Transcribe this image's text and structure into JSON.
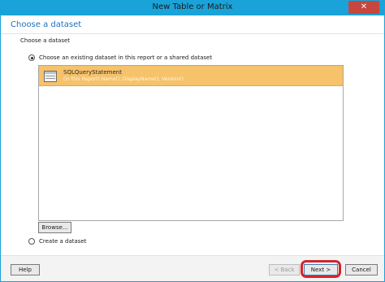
{
  "window": {
    "title": "New Table or Matrix",
    "close_glyph": "✕"
  },
  "header": {
    "title": "Choose a dataset"
  },
  "section": {
    "label": "Choose a dataset"
  },
  "options": {
    "existing_label": "Choose an existing dataset in this report or a shared dataset",
    "create_label": "Create a dataset"
  },
  "datasets": [
    {
      "name": "SQLQueryStatement",
      "details": "(in this Report) Name(), DisplayName(), Version()",
      "selected": true,
      "icon": "dataset-table-icon"
    }
  ],
  "buttons": {
    "browse": "Browse...",
    "help": "Help",
    "back": "< Back",
    "next": "Next >",
    "cancel": "Cancel"
  },
  "colors": {
    "titlebar": "#1aa3d9",
    "selection": "#f6c26a",
    "header_text": "#1e6fc2",
    "highlight": "#d2262c"
  }
}
